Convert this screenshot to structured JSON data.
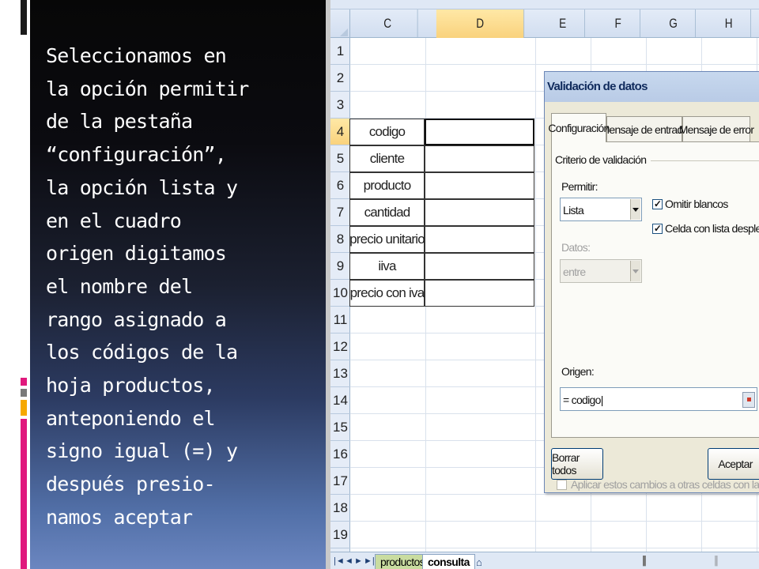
{
  "slide": {
    "lines": [
      "Seleccionamos en",
      "la opción permitir",
      "de la pestaña",
      "“configuración”,",
      "la opción lista y",
      "en el cuadro",
      "origen digitamos",
      "el nombre del",
      "rango asignado a",
      "los códigos de la",
      "hoja productos,",
      "anteponiendo el",
      "signo igual (=) y",
      "después presio-",
      "namos aceptar"
    ]
  },
  "excel": {
    "columns": [
      "C",
      "D",
      "E",
      "F",
      "G",
      "H"
    ],
    "active_column": "D",
    "rows": [
      "1",
      "2",
      "3",
      "4",
      "5",
      "6",
      "7",
      "8",
      "9",
      "10",
      "11",
      "12",
      "13",
      "14",
      "15",
      "16",
      "17",
      "18",
      "19"
    ],
    "active_row": "4",
    "table_labels": [
      "codigo",
      "cliente",
      "producto",
      "cantidad",
      "precio unitario",
      "iiva",
      "precio con iva"
    ],
    "sheet_tabs": [
      "productos",
      "consulta"
    ],
    "active_sheet": "consulta"
  },
  "dialog": {
    "title": "Validación de datos",
    "tabs": [
      "Configuración",
      "Mensaje de entrada",
      "Mensaje de error"
    ],
    "active_tab": "Configuración",
    "section_label": "Criterio de validación",
    "allow_label": "Permitir:",
    "allow_value": "Lista",
    "ignore_blank_label": "Omitir blancos",
    "ignore_blank_checked": true,
    "in_cell_dropdown_label": "Celda con lista desplegable",
    "in_cell_dropdown_checked": true,
    "data_label": "Datos:",
    "data_value": "entre",
    "source_label": "Origen:",
    "source_value": "= codigo|",
    "apply_all_label": "Aplicar estos cambios a otras celdas con la misma configu",
    "clear_all_button": "Borrar todos",
    "accept_button": "Aceptar"
  },
  "colors": {
    "panel_top": "#070707",
    "panel_bottom": "#6b86c0",
    "accent_stripe": "#e0197d",
    "accent_orange": "#f6a800"
  }
}
